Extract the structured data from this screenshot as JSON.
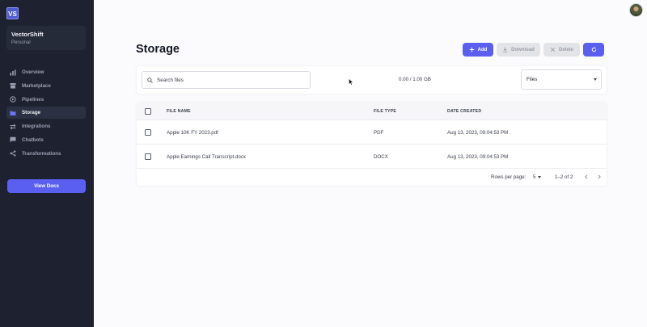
{
  "app": {
    "logo_text": "VS",
    "workspace_name": "VectorShift",
    "workspace_plan": "Personal"
  },
  "sidebar": {
    "items": [
      {
        "label": "Overview",
        "icon": "bar-chart-icon"
      },
      {
        "label": "Marketplace",
        "icon": "store-icon"
      },
      {
        "label": "Pipelines",
        "icon": "pipeline-icon"
      },
      {
        "label": "Storage",
        "icon": "folder-icon",
        "active": true
      },
      {
        "label": "Integrations",
        "icon": "swap-icon"
      },
      {
        "label": "Chatbots",
        "icon": "chat-icon"
      },
      {
        "label": "Transformations",
        "icon": "share-icon"
      }
    ],
    "docs_label": "View Docs"
  },
  "header": {
    "title": "Storage",
    "add_label": "Add",
    "download_label": "Download",
    "delete_label": "Delete"
  },
  "toolbar": {
    "search_placeholder": "Search files",
    "usage": "0.00 / 1.00 GB",
    "filter_value": "Files"
  },
  "table": {
    "columns": [
      "FILE NAME",
      "FILE TYPE",
      "DATE CREATED"
    ],
    "rows": [
      {
        "name": "Apple 10K FY 2023.pdf",
        "type": "PDF",
        "date": "Aug 13, 2023, 09:04:53 PM"
      },
      {
        "name": "Apple Earnings Call Transcript.docx",
        "type": "DOCX",
        "date": "Aug 13, 2023, 09:04:53 PM"
      }
    ],
    "rows_per_page_label": "Rows per page:",
    "rows_per_page": "5",
    "range": "1–2 of 2"
  },
  "colors": {
    "accent": "#5a5ff0",
    "sidebar_bg": "#1e2230",
    "disabled_btn": "#e3e4e8"
  }
}
